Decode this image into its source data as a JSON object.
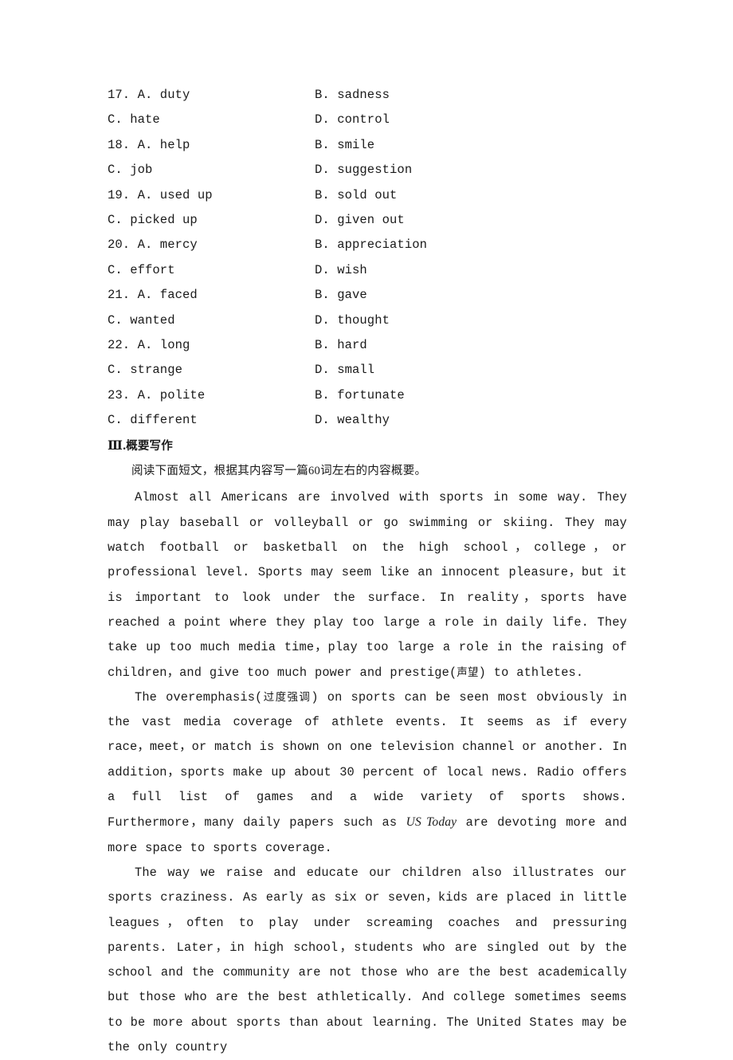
{
  "document": {
    "type": "english-exam-worksheet-page",
    "background_color": "#ffffff",
    "text_color": "#1a1a1a"
  },
  "multiple_choice": {
    "rows": [
      {
        "left": "17. A. duty",
        "right": "B. sadness"
      },
      {
        "left": "C. hate",
        "right": "D. control"
      },
      {
        "left": "18. A. help",
        "right": "B. smile"
      },
      {
        "left": "C. job",
        "right": "D. suggestion"
      },
      {
        "left": "19. A. used up",
        "right": "B. sold out"
      },
      {
        "left": "C. picked up",
        "right": "D. given out"
      },
      {
        "left": "20. A. mercy",
        "right": "B. appreciation"
      },
      {
        "left": "C. effort",
        "right": "D. wish"
      },
      {
        "left": "21. A. faced",
        "right": "B. gave"
      },
      {
        "left": "C. wanted",
        "right": "D. thought"
      },
      {
        "left": "22. A. long",
        "right": "B. hard"
      },
      {
        "left": "C. strange",
        "right": "D. small"
      },
      {
        "left": "23. A. polite",
        "right": "B. fortunate"
      },
      {
        "left": "C. different",
        "right": "D. wealthy"
      }
    ]
  },
  "section": {
    "numeral": "Ⅲ.",
    "title_cn": "概要写作",
    "instruction_cn_before": "阅读下面短文，根据其内容写一篇",
    "instruction_number": "60",
    "instruction_cn_after": "词左右的内容概要。"
  },
  "passage": {
    "paragraph_1_part1": "Almost all Americans are involved with sports in some way. They may play baseball or volleyball or go swimming or skiing. They may watch football or basketball on the high school，college，or professional level. Sports may seem like an innocent pleasure，but it is important to look under the surface. In reality，sports have reached a point where they play too large a role in daily life. They take up too much media time，play too large a role in the raising of children，and give too much power and prestige(",
    "paragraph_1_gloss": "声望",
    "paragraph_1_part2": ") to athletes.",
    "paragraph_2_part1": "The overemphasis(",
    "paragraph_2_gloss": "过度强调",
    "paragraph_2_part2": ") on sports can be seen most obviously in the vast media coverage of athlete events. It seems as if every race，meet，or match is shown on one television channel or another. In addition，sports make up about 30 percent of local news. Radio offers a full list of games and a wide variety of sports shows. Furthermore，many daily papers such as ",
    "paragraph_2_italic": "US Today",
    "paragraph_2_part3": " are devoting more and more space to sports coverage.",
    "paragraph_3": "The way we raise and educate our children also illustrates our sports craziness. As early as six or seven，kids are placed in little leagues，often to play under screaming coaches and pressuring parents. Later，in high school，students who are singled out by the school and the community are not those who are the best academically but those who are the best athletically. And college sometimes seems to be more about sports than about learning. The United States may be the only country"
  }
}
